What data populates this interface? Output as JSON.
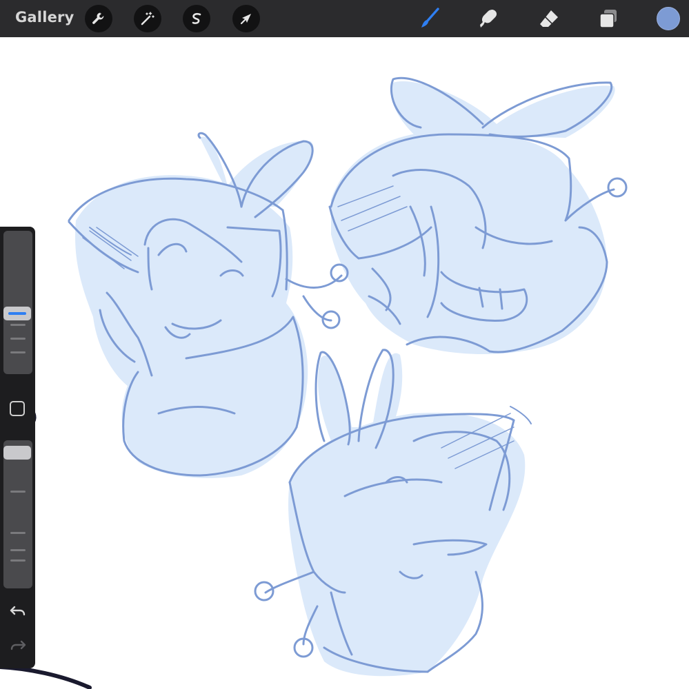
{
  "topbar": {
    "gallery_label": "Gallery",
    "left_tools": [
      "wrench-icon",
      "magic-wand-icon",
      "selection-icon",
      "transform-arrow-icon"
    ],
    "right_tools": [
      "brush-icon",
      "smudge-icon",
      "eraser-icon",
      "layers-icon"
    ],
    "active_tool": "brush",
    "active_color": "#7d9bd4"
  },
  "sidebar": {
    "brush_size_level": 0.35,
    "opacity_level": 0.95,
    "controls": [
      "brush-size-slider",
      "modify-button",
      "opacity-slider",
      "undo-icon",
      "redo-icon"
    ]
  },
  "colors": {
    "topbar": "#2b2b2d",
    "accent": "#2f7ff2",
    "sketch_line": "#7d9bd4",
    "sketch_fill": "#dbe9fa"
  }
}
